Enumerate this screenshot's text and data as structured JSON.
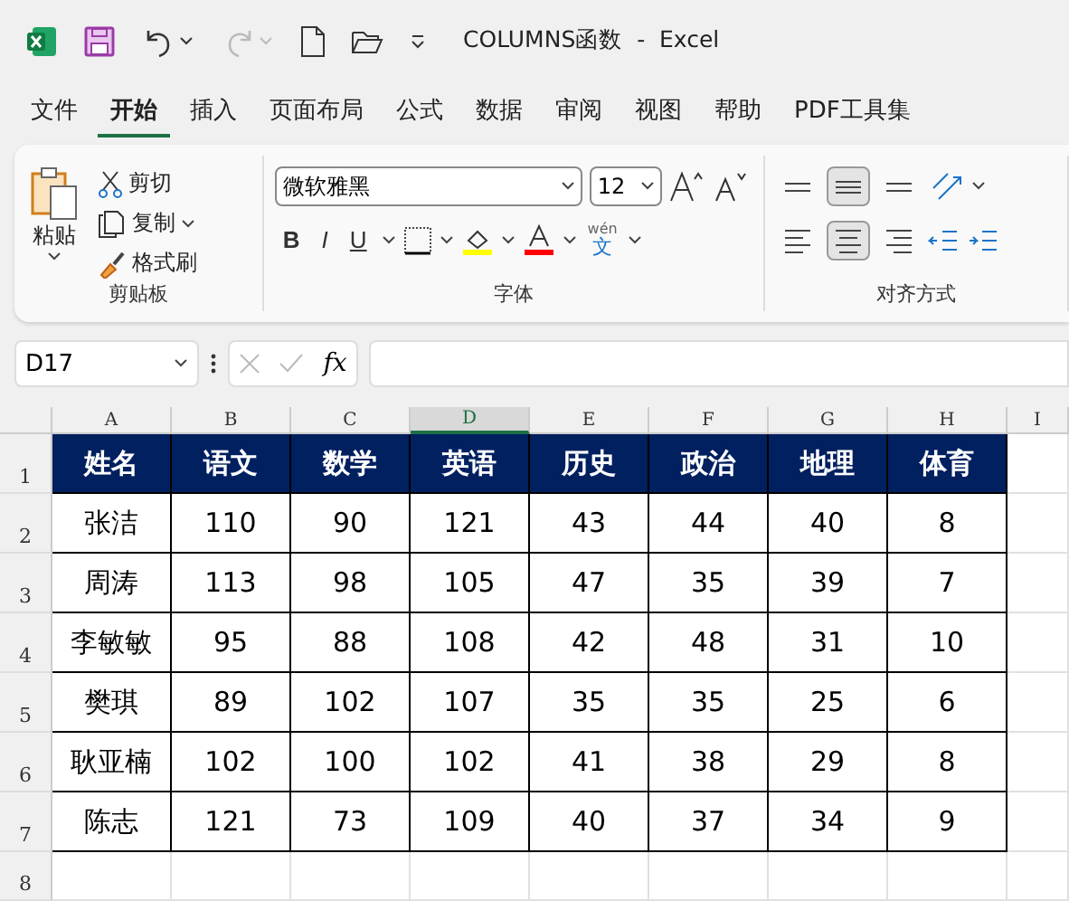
{
  "window": {
    "title": "COLUMNS函数  -  Excel"
  },
  "tabs": [
    {
      "label": "文件",
      "selected": false
    },
    {
      "label": "开始",
      "selected": true
    },
    {
      "label": "插入",
      "selected": false
    },
    {
      "label": "页面布局",
      "selected": false
    },
    {
      "label": "公式",
      "selected": false
    },
    {
      "label": "数据",
      "selected": false
    },
    {
      "label": "审阅",
      "selected": false
    },
    {
      "label": "视图",
      "selected": false
    },
    {
      "label": "帮助",
      "selected": false
    },
    {
      "label": "PDF工具集",
      "selected": false
    }
  ],
  "clipboard": {
    "paste": "粘贴",
    "cut": "剪切",
    "copy": "复制",
    "format_painter": "格式刷",
    "label": "剪贴板"
  },
  "font": {
    "name": "微软雅黑",
    "size": "12",
    "bold": "B",
    "italic": "I",
    "underline": "U",
    "phonetic_top": "wén",
    "phonetic_bottom": "文",
    "label": "字体"
  },
  "alignment": {
    "label": "对齐方式",
    "middle_align_selected": true,
    "center_selected": true
  },
  "formula_bar": {
    "name_box": "D17",
    "fx": "fx"
  },
  "sheet": {
    "columns": [
      {
        "label": "A",
        "selected": false
      },
      {
        "label": "B",
        "selected": false
      },
      {
        "label": "C",
        "selected": false
      },
      {
        "label": "D",
        "selected": true
      },
      {
        "label": "E",
        "selected": false
      },
      {
        "label": "F",
        "selected": false
      },
      {
        "label": "G",
        "selected": false
      },
      {
        "label": "H",
        "selected": false
      },
      {
        "label": "I",
        "selected": false
      }
    ],
    "row_numbers": [
      "1",
      "2",
      "3",
      "4",
      "5",
      "6",
      "7",
      "8"
    ],
    "header": [
      "姓名",
      "语文",
      "数学",
      "英语",
      "历史",
      "政治",
      "地理",
      "体育"
    ],
    "rows": [
      [
        "张洁",
        "110",
        "90",
        "121",
        "43",
        "44",
        "40",
        "8"
      ],
      [
        "周涛",
        "113",
        "98",
        "105",
        "47",
        "35",
        "39",
        "7"
      ],
      [
        "李敏敏",
        "95",
        "88",
        "108",
        "42",
        "48",
        "31",
        "10"
      ],
      [
        "樊琪",
        "89",
        "102",
        "107",
        "35",
        "35",
        "25",
        "6"
      ],
      [
        "耿亚楠",
        "102",
        "100",
        "102",
        "41",
        "38",
        "29",
        "8"
      ],
      [
        "陈志",
        "121",
        "73",
        "109",
        "40",
        "37",
        "34",
        "9"
      ]
    ]
  }
}
